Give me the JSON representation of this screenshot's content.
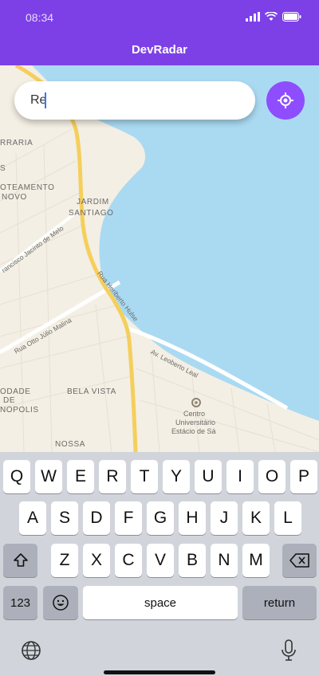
{
  "status": {
    "time": "08:34"
  },
  "header": {
    "title": "DevRadar"
  },
  "search": {
    "value": "Re"
  },
  "map": {
    "labels": [
      "RRARIA",
      "S",
      "OTEAMENTO",
      "NOVO",
      "JARDIM",
      "SANTIAGO",
      "BELA VISTA",
      "ODADE",
      "DE",
      "NOPOLIS",
      "NOSSA",
      "Centro",
      "Universitário",
      "Estácio de Sá"
    ],
    "streets": [
      "rancisco Jacinto de Melo",
      "Rua Otto Júlio Malina",
      "Rua Heriberto Hulse",
      "Av. Leoberto Leal"
    ]
  },
  "keyboard": {
    "row1": [
      "Q",
      "W",
      "E",
      "R",
      "T",
      "Y",
      "U",
      "I",
      "O",
      "P"
    ],
    "row2": [
      "A",
      "S",
      "D",
      "F",
      "G",
      "H",
      "J",
      "K",
      "L"
    ],
    "row3": [
      "Z",
      "X",
      "C",
      "V",
      "B",
      "N",
      "M"
    ],
    "numbers_label": "123",
    "space_label": "space",
    "return_label": "return"
  }
}
